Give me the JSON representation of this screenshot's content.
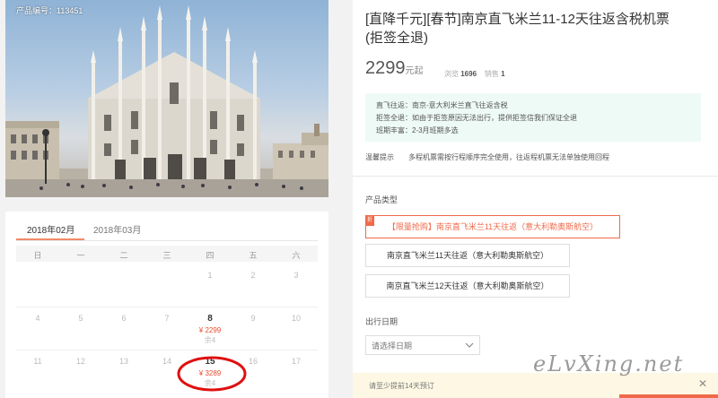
{
  "product": {
    "code_label": "产品编号：113451",
    "title": "[直降千元][春节]南京直飞米兰11-12天往返含税机票(拒签全退)",
    "price": "2299",
    "price_unit": "元起",
    "stats": {
      "views_label": "浏览",
      "views": "1696",
      "sales_label": "销售",
      "sales": "1"
    }
  },
  "notice": [
    "直飞往返：南京-意大利米兰直飞往返含税",
    "拒签全退：如由于拒签原因无法出行，提供拒签信我们保证全退",
    "班期丰富：2-3月班期多选"
  ],
  "tip": {
    "label": "温馨提示",
    "text": "多程机票需按行程顺序完全使用，往返程机票无法单独使用回程"
  },
  "product_type": {
    "label": "产品类型",
    "badge": "折",
    "options": [
      "【限量抢购】南京直飞米兰11天往返（意大利勒奥斯航空）",
      "南京直飞米兰11天往返（意大利勒奥斯航空）",
      "南京直飞米兰12天往返（意大利勒奥斯航空）"
    ]
  },
  "departure": {
    "label": "出行日期",
    "placeholder": "请选择日期"
  },
  "bottom_notice": "请至少提前14天预订",
  "calendar": {
    "tabs": [
      "2018年02月",
      "2018年03月"
    ],
    "weekdays": [
      "日",
      "一",
      "二",
      "三",
      "四",
      "五",
      "六"
    ],
    "rows": [
      [
        {
          "day": ""
        },
        {
          "day": ""
        },
        {
          "day": ""
        },
        {
          "day": ""
        },
        {
          "day": "1"
        },
        {
          "day": "2"
        },
        {
          "day": "3"
        }
      ],
      [
        {
          "day": "4"
        },
        {
          "day": "5"
        },
        {
          "day": "6"
        },
        {
          "day": "7"
        },
        {
          "day": "8",
          "price": "¥ 2299",
          "remain": "余4"
        },
        {
          "day": "9"
        },
        {
          "day": "10"
        }
      ],
      [
        {
          "day": "11"
        },
        {
          "day": "12"
        },
        {
          "day": "13"
        },
        {
          "day": "14"
        },
        {
          "day": "15",
          "price": "¥ 3289",
          "remain": "余4"
        },
        {
          "day": "16"
        },
        {
          "day": "17"
        }
      ]
    ]
  },
  "watermark": "eLvXing.net",
  "colors": {
    "accent": "#f06a4a",
    "price": "#e84a2b",
    "notice_bg": "#eefaf6",
    "circle": "#e01010"
  }
}
